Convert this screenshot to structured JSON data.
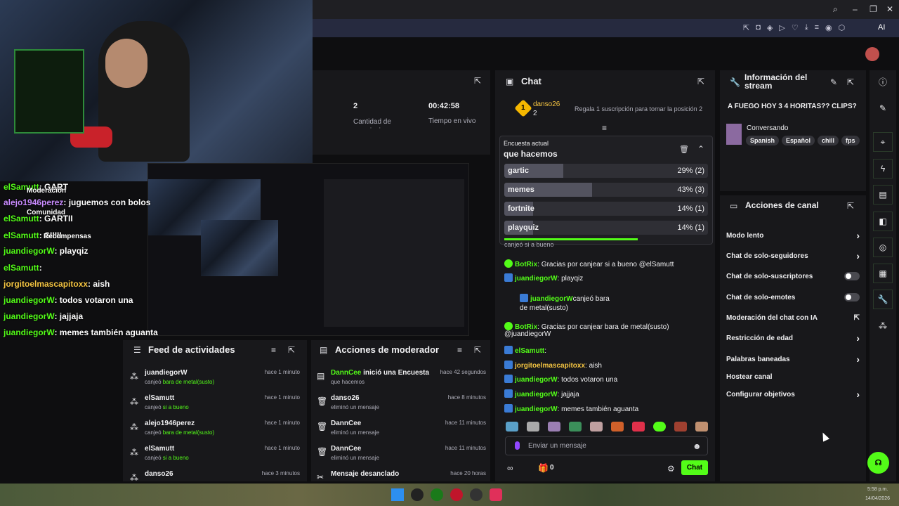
{
  "browser": {
    "icons": [
      "search-icon",
      "minimize-icon",
      "restore-icon",
      "close-icon"
    ],
    "ai_label": "AI"
  },
  "overlay": {
    "lines": [
      {
        "user": "elSamutt",
        "text": ": GART",
        "color": "#53fc18"
      },
      {
        "user": "",
        "text": "Moderación",
        "color": "#efeff1"
      },
      {
        "user": "alejo1946perez",
        "text": ": juguemos con bolos",
        "color": "#c98bff"
      },
      {
        "user": "",
        "text": "Comunidad",
        "color": "#efeff1"
      },
      {
        "user": "elSamutt",
        "text": ": GARTII",
        "color": "#53fc18"
      },
      {
        "user": "elSamutt",
        "text": ": SIIIII",
        "color": "#53fc18"
      },
      {
        "user": "",
        "text": "Recompensas",
        "color": "#efeff1"
      },
      {
        "user": "juandiegorW",
        "text": ": playqiz",
        "color": "#53fc18"
      },
      {
        "user": "elSamutt",
        "text": ":",
        "color": "#53fc18"
      },
      {
        "user": "jorgitoelmascapitoxx",
        "text": ": aish",
        "color": "#f5c542"
      },
      {
        "user": "juandiegorW",
        "text": ": todos votaron una",
        "color": "#53fc18"
      },
      {
        "user": "juandiegorW",
        "text": ": jajjaja",
        "color": "#53fc18"
      },
      {
        "user": "juandiegorW",
        "text": ": memes también aguanta",
        "color": "#53fc18"
      }
    ]
  },
  "stats": {
    "viewers": "2",
    "viewers_label": "Cantidad de suscripciones",
    "time": "00:42:58",
    "time_label": "Tiempo en vivo"
  },
  "chat": {
    "title": "Chat",
    "top_user": "danso26",
    "top_count": "2",
    "top_rank": "1",
    "gift_text": "Regala 1 suscripción para tomar la posición 2",
    "poll": {
      "label": "Encuesta actual",
      "question": "que hacemos",
      "options": [
        {
          "name": "gartic",
          "pct": 29,
          "text": "29% (2)"
        },
        {
          "name": "memes",
          "pct": 43,
          "text": "43% (3)"
        },
        {
          "name": "fortnite",
          "pct": 14,
          "text": "14% (1)"
        },
        {
          "name": "playquiz",
          "pct": 14,
          "text": "14% (1)"
        }
      ]
    },
    "clipped": "canjeó si a bueno",
    "messages": [
      {
        "user": "BotRix",
        "text": ": Gracias por canjear si a bueno @elSamutt",
        "color": "#53fc18"
      },
      {
        "user": "juandiegorW",
        "text": ": playqiz",
        "color": "#53fc18"
      },
      {
        "user": "juandiegorW",
        "text": "canjeó bara de metal(susto)",
        "color": "#53fc18"
      },
      {
        "user": "BotRix",
        "text": ": Gracias por canjear bara de metal(susto)",
        "color": "#53fc18"
      },
      {
        "user": "",
        "text": "@juandiegorW",
        "color": "#efeff1"
      },
      {
        "user": "elSamutt",
        "text": ":",
        "color": "#53fc18"
      },
      {
        "user": "jorgitoelmascapitoxx",
        "text": ": aish",
        "color": "#f5c542"
      },
      {
        "user": "juandiegorW",
        "text": ": todos votaron una",
        "color": "#53fc18"
      },
      {
        "user": "juandiegorW",
        "text": ": jajjaja",
        "color": "#53fc18"
      },
      {
        "user": "juandiegorW",
        "text": ": memes también aguanta",
        "color": "#53fc18"
      }
    ],
    "input_placeholder": "Enviar un mensaje",
    "send_label": "Chat",
    "count": "0"
  },
  "activity": {
    "title": "Feed de actividades",
    "items": [
      {
        "user": "juandiegorW",
        "pre": "canjeó ",
        "reward": "bara de metal(susto)",
        "time": "hace 1 minuto"
      },
      {
        "user": "elSamutt",
        "pre": "canjeó ",
        "reward": "si a bueno",
        "time": "hace 1 minuto"
      },
      {
        "user": "alejo1946perez",
        "pre": "canjeó ",
        "reward": "bara de metal(susto)",
        "time": "hace 1 minuto"
      },
      {
        "user": "elSamutt",
        "pre": "canjeó ",
        "reward": "si a bueno",
        "time": "hace 1 minuto"
      },
      {
        "user": "danso26",
        "pre": "",
        "reward": "",
        "time": "hace 3 minutos"
      }
    ]
  },
  "moderator": {
    "title": "Acciones de moderador",
    "items": [
      {
        "user": "DannCee",
        "action": " inició una Encuesta",
        "detail": "que hacemos",
        "time": "hace 42 segundos"
      },
      {
        "user": "danso26",
        "action": "",
        "detail": "eliminó un mensaje",
        "time": "hace 8 minutos"
      },
      {
        "user": "DannCee",
        "action": "",
        "detail": "eliminó un mensaje",
        "time": "hace 11 minutos"
      },
      {
        "user": "DannCee",
        "action": "",
        "detail": "eliminó un mensaje",
        "time": "hace 11 minutos"
      },
      {
        "user": "Mensaje desanclado",
        "action": "",
        "detail": "",
        "time": "hace 20 horas"
      }
    ]
  },
  "info": {
    "title": "Información del stream",
    "stream_title": "A FUEGO HOY 3 4 HORITAS?? CLIPS?",
    "category": "Conversando",
    "tags": [
      "Spanish",
      "Español",
      "chill",
      "fps"
    ]
  },
  "channel": {
    "title": "Acciones de canal",
    "items": [
      {
        "label": "Modo lento",
        "control": "chevron"
      },
      {
        "label": "Chat de solo-seguidores",
        "control": "chevron"
      },
      {
        "label": "Chat de solo-suscriptores",
        "control": "toggle"
      },
      {
        "label": "Chat de solo-emotes",
        "control": "toggle"
      },
      {
        "label": "Moderación del chat con IA",
        "control": "external"
      },
      {
        "label": "Restricción de edad",
        "control": "chevron"
      },
      {
        "label": "Palabras baneadas",
        "control": "chevron"
      },
      {
        "label": "Hostear canal",
        "control": "none"
      },
      {
        "label": "Configurar objetivos",
        "control": "chevron"
      }
    ]
  },
  "taskbar": {
    "time": "5:58 p.m.",
    "date": "14/04/2026"
  },
  "colors": {
    "accent": "#53fc18",
    "panel": "#18181b",
    "bg": "#0e0e10"
  }
}
